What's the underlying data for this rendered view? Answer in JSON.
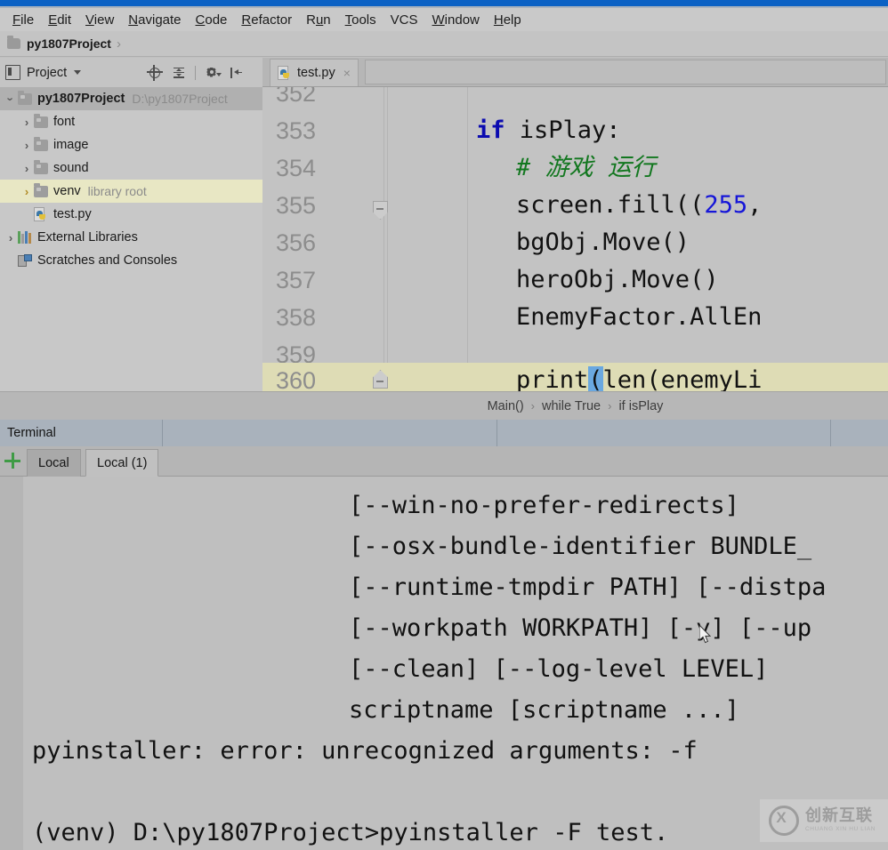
{
  "app": {
    "accent_color": "#0b61c4",
    "window_bg": "#c0c0c0"
  },
  "menubar": {
    "items": [
      {
        "mnemonic": "F",
        "rest": "ile"
      },
      {
        "mnemonic": "E",
        "rest": "dit"
      },
      {
        "mnemonic": "V",
        "rest": "iew"
      },
      {
        "mnemonic": "N",
        "rest": "avigate"
      },
      {
        "mnemonic": "C",
        "rest": "ode"
      },
      {
        "mnemonic": "R",
        "rest": "efactor"
      },
      {
        "mnemonic": "R",
        "rest": "un",
        "pre": "R",
        "post": "un"
      },
      {
        "mnemonic": "T",
        "rest": "ools"
      },
      {
        "mnemonic": "",
        "rest": "VCS"
      },
      {
        "mnemonic": "W",
        "rest": "indow"
      },
      {
        "mnemonic": "H",
        "rest": "elp"
      }
    ],
    "labels": [
      "File",
      "Edit",
      "View",
      "Navigate",
      "Code",
      "Refactor",
      "Run",
      "Tools",
      "VCS",
      "Window",
      "Help"
    ]
  },
  "navbar": {
    "project_name": "py1807Project",
    "separator": "›"
  },
  "project_panel": {
    "title": "Project",
    "actions": [
      "locate-icon",
      "collapse-all-icon",
      "settings-gear-icon",
      "hide-panel-icon"
    ],
    "tree": [
      {
        "label": "py1807Project",
        "sub": "D:\\py1807Project",
        "chevron": "expanded",
        "icon": "folder-icon",
        "bold": true,
        "selected": true
      },
      {
        "label": "font",
        "sub": "",
        "chevron": "collapsed",
        "icon": "folder-icon",
        "bold": false,
        "selected": false
      },
      {
        "label": "image",
        "sub": "",
        "chevron": "collapsed",
        "icon": "folder-icon",
        "bold": false,
        "selected": false
      },
      {
        "label": "sound",
        "sub": "",
        "chevron": "collapsed",
        "icon": "folder-icon",
        "bold": false,
        "selected": false
      },
      {
        "label": "venv",
        "sub": "library root",
        "chevron": "collapsed-orange",
        "icon": "folder-icon",
        "bold": false,
        "selected": false
      },
      {
        "label": "test.py",
        "sub": "",
        "chevron": "none",
        "icon": "python-file-icon",
        "bold": false,
        "selected": false
      },
      {
        "label": "External Libraries",
        "sub": "",
        "chevron": "collapsed",
        "icon": "libraries-icon",
        "bold": false,
        "selected": false
      },
      {
        "label": "Scratches and Consoles",
        "sub": "",
        "chevron": "none",
        "icon": "scratches-icon",
        "bold": false,
        "selected": false
      }
    ]
  },
  "editor": {
    "tab": {
      "label": "test.py",
      "close": "×",
      "icon": "python-file-icon"
    },
    "lines": [
      {
        "num": "352",
        "code": "",
        "partial": true
      },
      {
        "num": "353",
        "code": "if isPlay:"
      },
      {
        "num": "354",
        "code": "    # 游戏 运行"
      },
      {
        "num": "355",
        "code": "    screen.fill((255,"
      },
      {
        "num": "356",
        "code": "    bgObj.Move()"
      },
      {
        "num": "357",
        "code": "    heroObj.Move()"
      },
      {
        "num": "358",
        "code": "    EnemyFactor.AllEn"
      },
      {
        "num": "359",
        "code": ""
      },
      {
        "num": "360",
        "code": "    print(len(enemyLi",
        "current": true
      }
    ],
    "breadcrumb": [
      "Main()",
      "while True",
      "if isPlay"
    ],
    "breadcrumb_separator": "›",
    "colors": {
      "keyword": "#0b0bb0",
      "number": "#1616d8",
      "comment": "#12771f",
      "selection": "#6aa8e0",
      "current_line": "#dedcb5"
    }
  },
  "terminal": {
    "title": "Terminal",
    "add_icon": "add-icon",
    "close_icon": "close-icon",
    "tabs": [
      {
        "label": "Local",
        "active": false
      },
      {
        "label": "Local (1)",
        "active": true
      }
    ],
    "output": [
      "[--win-no-prefer-redirects]",
      "[--osx-bundle-identifier BUNDLE_",
      "[--runtime-tmpdir PATH] [--distpa",
      "[--workpath WORKPATH] [-y] [--up",
      "[--clean] [--log-level LEVEL]",
      "scriptname [scriptname ...]",
      "pyinstaller: error: unrecognized arguments: -f",
      "",
      "(venv) D:\\py1807Project>pyinstaller -F test."
    ]
  },
  "watermark": {
    "cn": "创新互联",
    "en": "CHUANG XIN HU LIAN",
    "logo": "circle-x-logo"
  }
}
